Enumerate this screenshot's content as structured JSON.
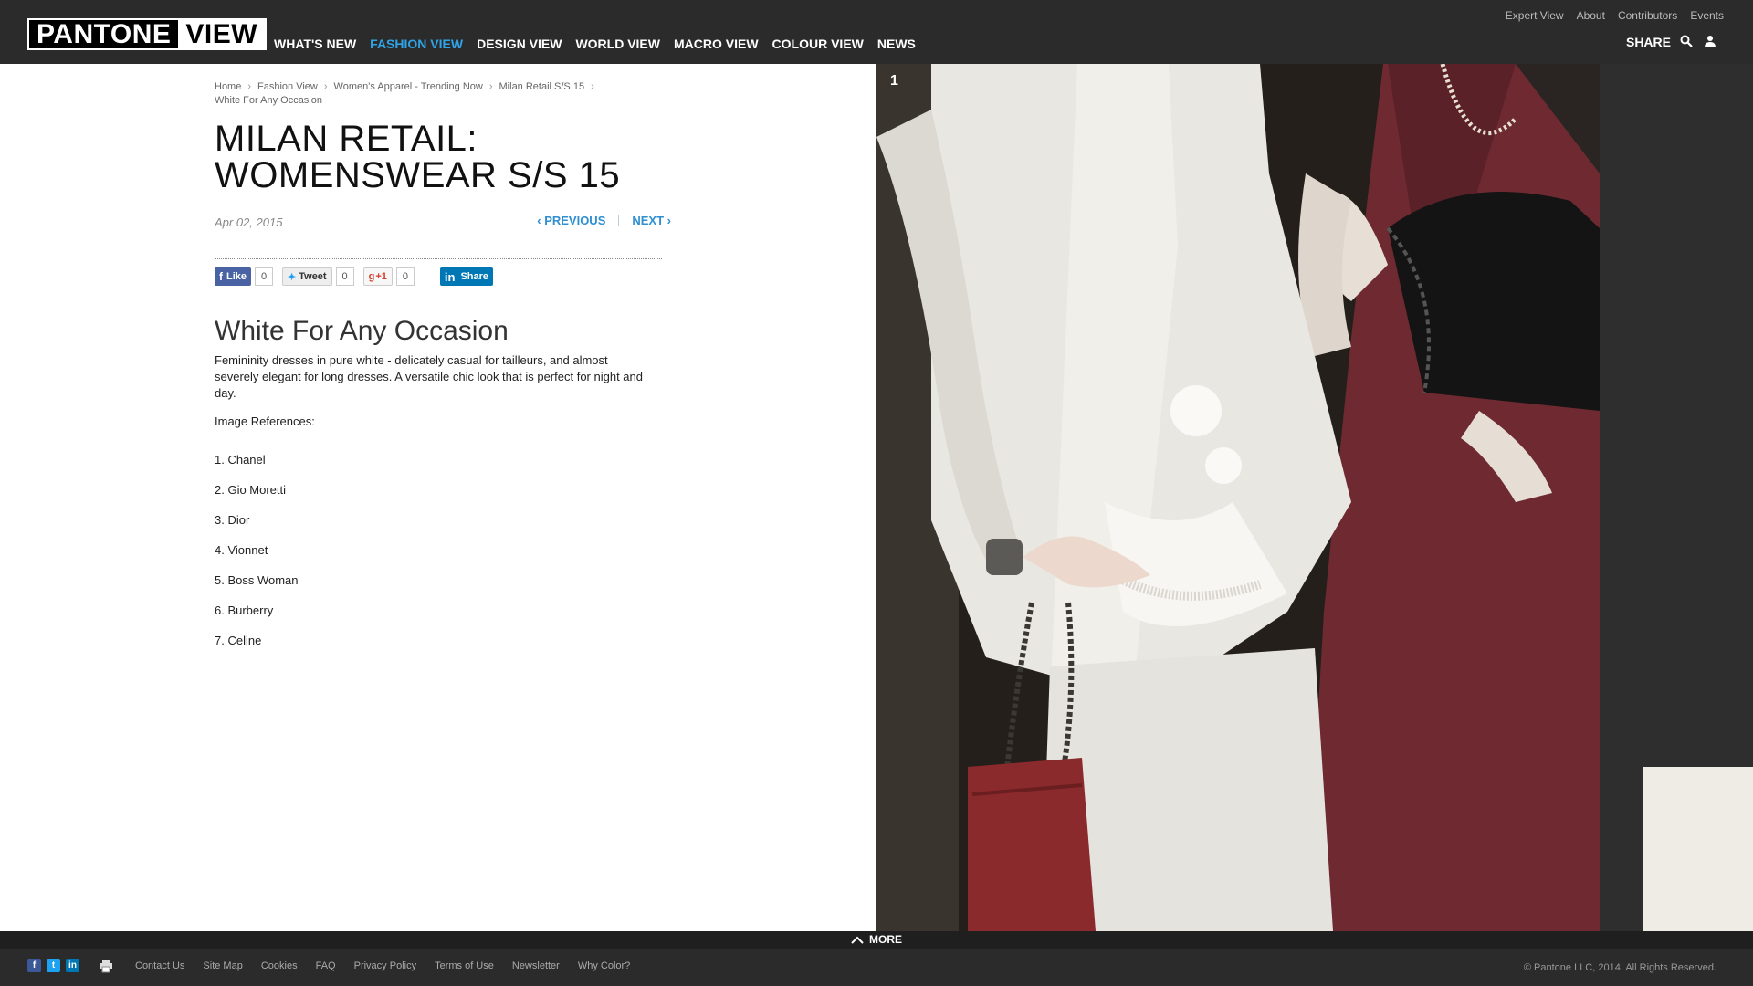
{
  "header": {
    "logo_left": "PANTONE",
    "logo_right": "VIEW",
    "main_nav": [
      {
        "label": "WHAT'S NEW",
        "active": false
      },
      {
        "label": "FASHION VIEW",
        "active": true
      },
      {
        "label": "DESIGN VIEW",
        "active": false
      },
      {
        "label": "WORLD VIEW",
        "active": false
      },
      {
        "label": "MACRO VIEW",
        "active": false
      },
      {
        "label": "COLOUR VIEW",
        "active": false
      },
      {
        "label": "NEWS",
        "active": false
      }
    ],
    "top_nav": [
      "Expert View",
      "About",
      "Contributors",
      "Events"
    ],
    "share_label": "SHARE",
    "accent_color": "#2fa4e7"
  },
  "breadcrumb": [
    "Home",
    "Fashion View",
    "Women's Apparel - Trending Now",
    "Milan Retail S/S 15",
    "White For Any Occasion"
  ],
  "article": {
    "title_line1": "MILAN RETAIL:",
    "title_line2": "WOMENSWEAR S/S 15",
    "date": "Apr 02, 2015",
    "previous_label": "PREVIOUS",
    "next_label": "NEXT",
    "subtitle": "White For Any Occasion",
    "description": "Femininity dresses in pure white - delicately casual for tailleurs, and almost severely elegant for long dresses. A versatile chic look that is perfect for night and day.",
    "references_heading": "Image References:",
    "references": [
      "1. Chanel",
      "2. Gio Moretti",
      "3. Dior",
      "4. Vionnet",
      "5. Boss Woman",
      "6. Burberry",
      "7. Celine"
    ]
  },
  "social": {
    "like_label": "Like",
    "like_count": "0",
    "tweet_label": "Tweet",
    "tweet_count": "0",
    "gplus_label": "+1",
    "gplus_count": "0",
    "share_label": "Share"
  },
  "gallery": {
    "image_number": "1"
  },
  "footer": {
    "more_label": "MORE",
    "links": [
      "Contact Us",
      "Site Map",
      "Cookies",
      "FAQ",
      "Privacy Policy",
      "Terms of Use",
      "Newsletter",
      "Why Color?"
    ],
    "copyright": "© Pantone LLC, 2014. All Rights Reserved."
  }
}
